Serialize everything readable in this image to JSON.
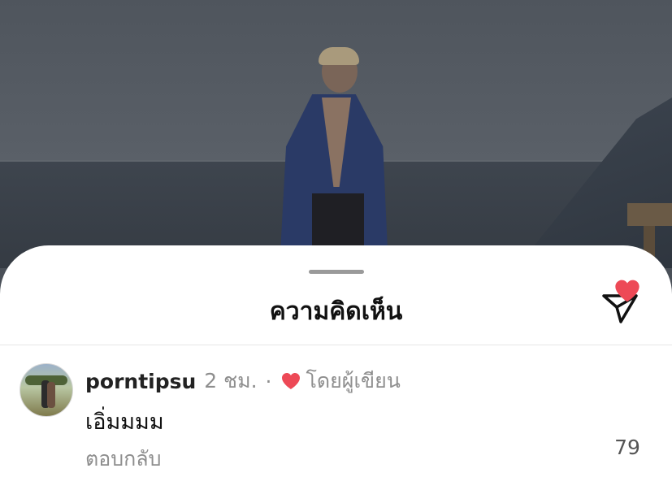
{
  "sheet": {
    "title": "ความคิดเห็น",
    "share_icon": "paper-plane-icon"
  },
  "comment": {
    "username": "porntipsu",
    "time": "2 ชม.",
    "separator": "·",
    "author_liked_label": "โดยผู้เขียน",
    "text": "เอิ่มมมม",
    "reply_label": "ตอบกลับ",
    "like_count": "79",
    "like_icon": "heart-filled-icon"
  },
  "colors": {
    "heart": "#ed4956",
    "muted_text": "#8e8e8e",
    "sheet_bg": "#ffffff"
  }
}
